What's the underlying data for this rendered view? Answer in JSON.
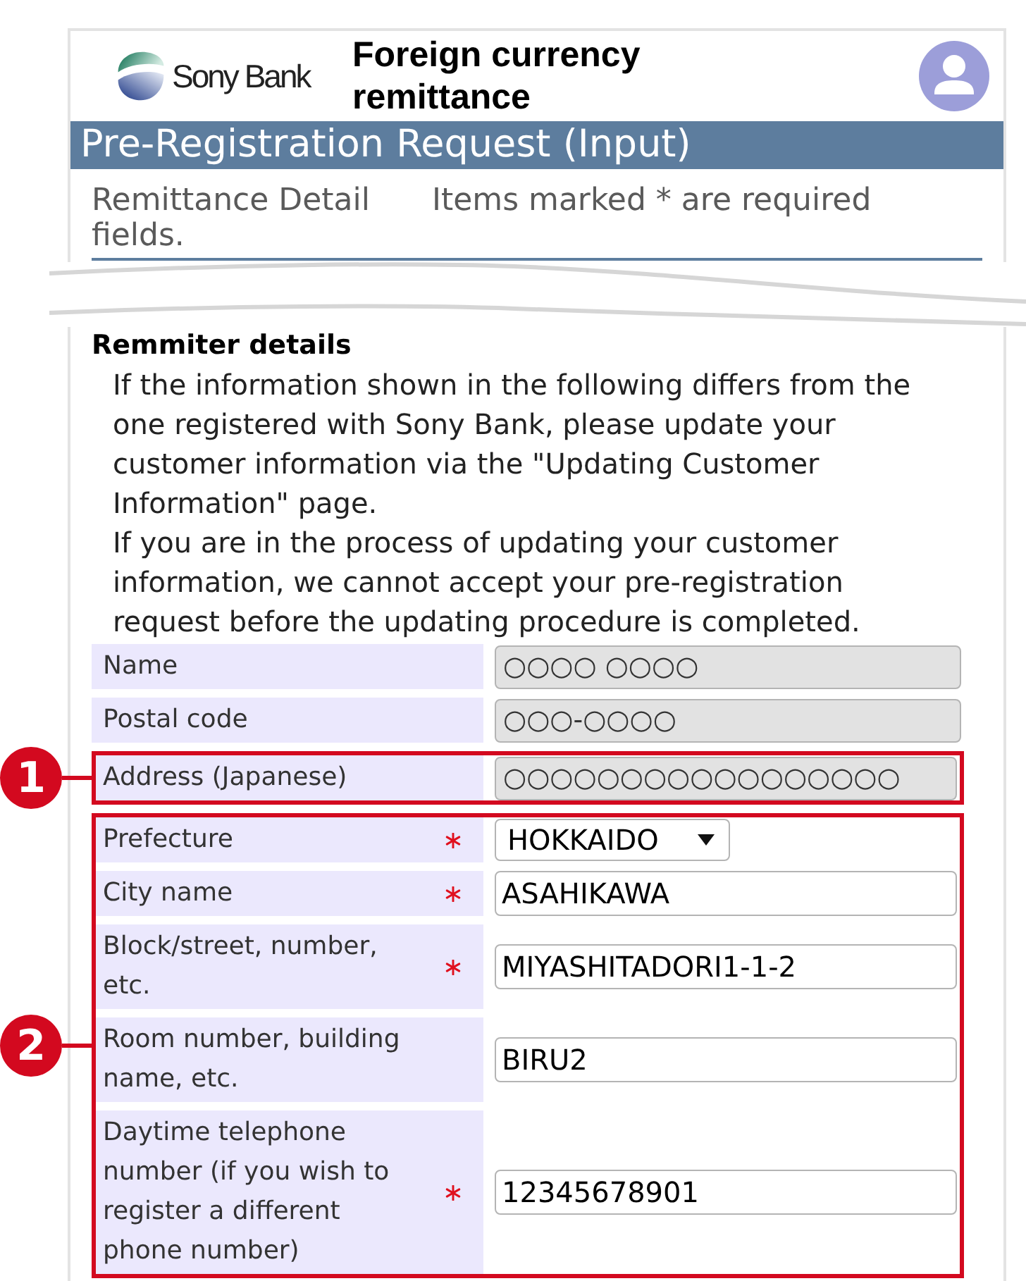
{
  "header": {
    "logo_text": "Sony Bank",
    "title": "Foreign currency remittance"
  },
  "page_title": "Pre-Registration Request (Input)",
  "subheader": {
    "section": "Remittance Detail",
    "required_note": "Items marked * are required fields."
  },
  "remitter": {
    "heading": "Remmiter details",
    "paragraphs": [
      "If the information shown in the following differs from the one registered with Sony Bank, please update your customer information via the \"Updating Customer Information\" page.",
      "If you are in the process of updating your customer information, we cannot accept your pre-registration request before the updating procedure is completed."
    ]
  },
  "form_groups": [
    {
      "rows": [
        {
          "label": "Name",
          "kind": "readonly",
          "required": false,
          "value": "○○○○ ○○○○"
        },
        {
          "label": "Postal code",
          "kind": "readonly",
          "required": false,
          "value": "○○○-○○○○"
        }
      ]
    },
    {
      "callout": "1",
      "rows": [
        {
          "label": "Address (Japanese)",
          "kind": "readonly",
          "required": false,
          "value": "○○○○○○○○○○○○○○○○○"
        }
      ]
    },
    {
      "callout": "2",
      "rows": [
        {
          "label": "Prefecture",
          "kind": "select",
          "required": true,
          "value": "HOKKAIDO"
        },
        {
          "label": "City name",
          "kind": "text",
          "required": true,
          "value": "ASAHIKAWA"
        },
        {
          "label": "Block/street, number, etc.",
          "kind": "text",
          "required": true,
          "value": "MIYASHITADORI1-1-2"
        },
        {
          "label": "Room number, building name, etc.",
          "kind": "text",
          "required": false,
          "value": "BIRU2"
        },
        {
          "label": "Daytime telephone number (if you wish to register a different phone number)",
          "kind": "text",
          "required": true,
          "value": "12345678901"
        }
      ]
    }
  ]
}
